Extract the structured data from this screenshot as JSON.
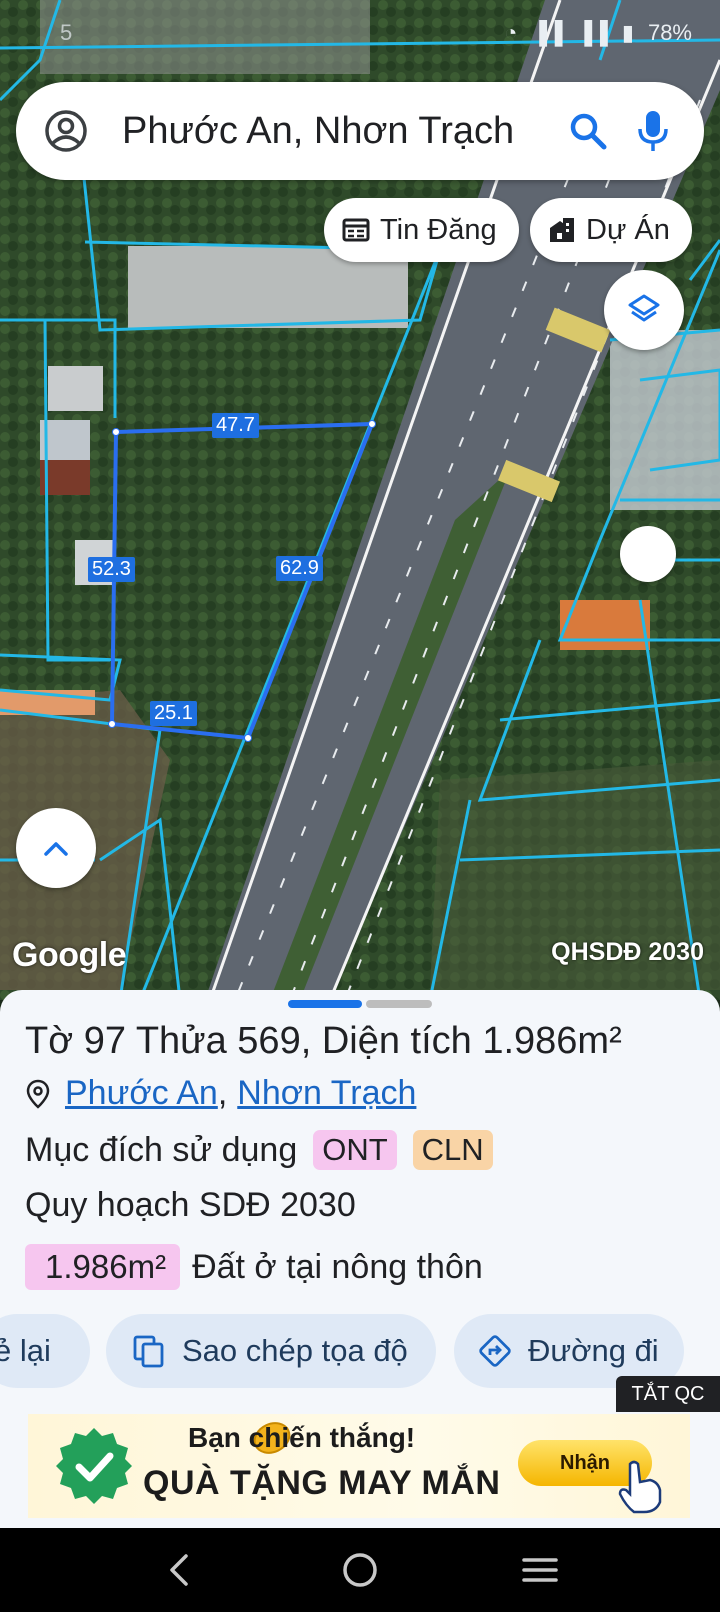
{
  "status_bar": {
    "time": "5",
    "battery": "78%"
  },
  "search": {
    "text": "Phước An, Nhơn Trạch"
  },
  "chips": {
    "listings": "Tin Đăng",
    "projects": "Dự Án"
  },
  "map": {
    "measurements": {
      "top": "47.7",
      "left": "52.3",
      "diagonal": "62.9",
      "bottom": "25.1"
    },
    "google_logo": "Google",
    "layer_label": "QHSDĐ 2030",
    "colors": {
      "parcel_lines": "#23b8e6",
      "selection": "#2a6ef0",
      "road": "#5f6670"
    }
  },
  "parcel": {
    "title": "Tờ 97 Thửa 569, Diện tích 1.986m²",
    "location": {
      "ward": "Phước An",
      "separator": ",",
      "district": "Nhơn Trạch"
    },
    "purpose_label": "Mục đích sử dụng",
    "purpose_tags": [
      "ONT",
      "CLN"
    ],
    "plan_label": "Quy hoạch SDĐ 2030",
    "plan_area": "1.986m²",
    "plan_desc": "Đất ở tại nông thôn"
  },
  "actions": {
    "share_partial": "ẻ lại",
    "copy_coords": "Sao chép tọa độ",
    "directions": "Đường đi"
  },
  "ad": {
    "off_label": "TẮT QC",
    "line1": "Bạn chiến thắng!",
    "line2": "QUÀ TẶNG MAY MẮN",
    "cta": "Nhận"
  }
}
